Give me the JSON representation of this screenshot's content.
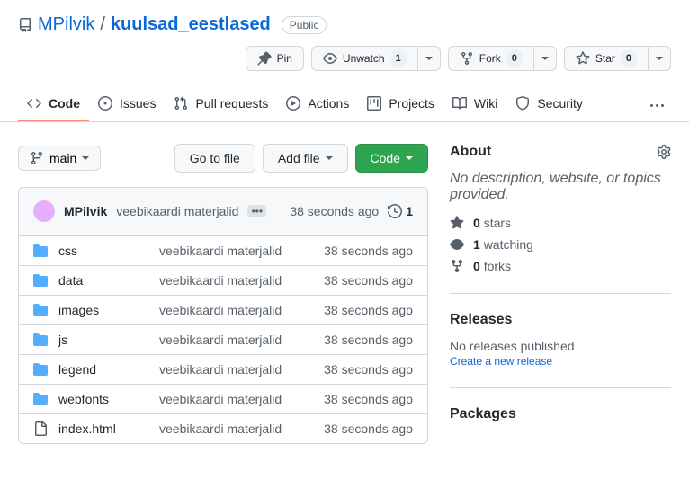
{
  "breadcrumb": {
    "owner": "MPilvik",
    "repo": "kuulsad_eestlased",
    "visibility": "Public"
  },
  "repo_actions": {
    "pin": "Pin",
    "unwatch": "Unwatch",
    "unwatch_count": "1",
    "fork": "Fork",
    "fork_count": "0",
    "star": "Star",
    "star_count": "0"
  },
  "tabs": {
    "code": "Code",
    "issues": "Issues",
    "pulls": "Pull requests",
    "actions": "Actions",
    "projects": "Projects",
    "wiki": "Wiki",
    "security": "Security"
  },
  "branch": {
    "name": "main"
  },
  "buttons": {
    "goto": "Go to file",
    "add": "Add file",
    "code": "Code"
  },
  "commit": {
    "author": "MPilvik",
    "message": "veebikaardi materjalid",
    "time": "38 seconds ago",
    "history_count": "1"
  },
  "files": [
    {
      "type": "dir",
      "name": "css",
      "msg": "veebikaardi materjalid",
      "time": "38 seconds ago"
    },
    {
      "type": "dir",
      "name": "data",
      "msg": "veebikaardi materjalid",
      "time": "38 seconds ago"
    },
    {
      "type": "dir",
      "name": "images",
      "msg": "veebikaardi materjalid",
      "time": "38 seconds ago"
    },
    {
      "type": "dir",
      "name": "js",
      "msg": "veebikaardi materjalid",
      "time": "38 seconds ago"
    },
    {
      "type": "dir",
      "name": "legend",
      "msg": "veebikaardi materjalid",
      "time": "38 seconds ago"
    },
    {
      "type": "dir",
      "name": "webfonts",
      "msg": "veebikaardi materjalid",
      "time": "38 seconds ago"
    },
    {
      "type": "file",
      "name": "index.html",
      "msg": "veebikaardi materjalid",
      "time": "38 seconds ago"
    }
  ],
  "about": {
    "title": "About",
    "desc": "No description, website, or topics provided.",
    "stars": "0",
    "stars_label": "stars",
    "watching": "1",
    "watching_label": "watching",
    "forks": "0",
    "forks_label": "forks"
  },
  "releases": {
    "title": "Releases",
    "empty": "No releases published",
    "create": "Create a new release"
  },
  "packages": {
    "title": "Packages"
  }
}
